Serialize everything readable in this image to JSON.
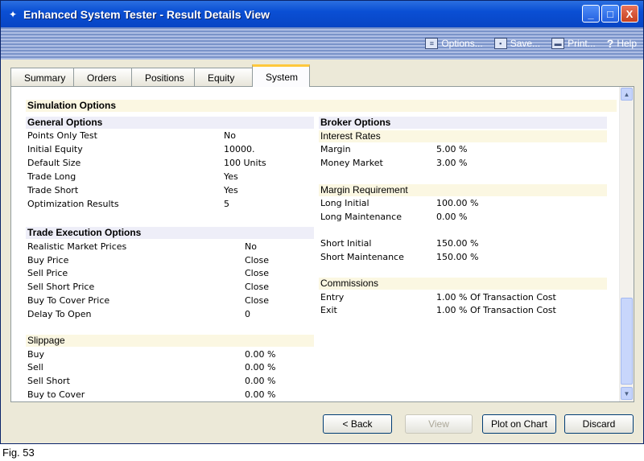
{
  "window": {
    "title": "Enhanced System Tester - Result Details View",
    "controls": {
      "minimize": "_",
      "maximize": "□",
      "close": "X"
    }
  },
  "toolbar": {
    "options_label": "Options...",
    "save_label": "Save...",
    "print_label": "Print...",
    "help_label": "Help"
  },
  "tabs": [
    {
      "label": "Summary"
    },
    {
      "label": "Orders"
    },
    {
      "label": "Positions"
    },
    {
      "label": "Equity"
    },
    {
      "label": "System"
    }
  ],
  "active_tab": "System",
  "simulation": {
    "title": "Simulation Options",
    "general": {
      "title": "General Options",
      "rows": [
        {
          "label": "Points Only Test",
          "value": "No"
        },
        {
          "label": "Initial Equity",
          "value": "10000."
        },
        {
          "label": "Default Size",
          "value": "100 Units"
        },
        {
          "label": "Trade Long",
          "value": "Yes"
        },
        {
          "label": "Trade Short",
          "value": "Yes"
        },
        {
          "label": "Optimization Results",
          "value": "5"
        }
      ]
    },
    "trade_execution": {
      "title": "Trade Execution Options",
      "rows": [
        {
          "label": "Realistic Market Prices",
          "value": "No"
        },
        {
          "label": "Buy Price",
          "value": "Close"
        },
        {
          "label": "Sell Price",
          "value": "Close"
        },
        {
          "label": "Sell Short Price",
          "value": "Close"
        },
        {
          "label": "Buy To Cover Price",
          "value": "Close"
        },
        {
          "label": "Delay To Open",
          "value": "0"
        }
      ]
    },
    "slippage": {
      "title": "Slippage",
      "rows": [
        {
          "label": "Buy",
          "value": "0.00 %"
        },
        {
          "label": "Sell",
          "value": "0.00 %"
        },
        {
          "label": "Sell Short",
          "value": "0.00 %"
        },
        {
          "label": "Buy to Cover",
          "value": "0.00 %"
        }
      ]
    },
    "broker": {
      "title": "Broker Options",
      "interest": {
        "title": "Interest Rates",
        "rows": [
          {
            "label": "Margin",
            "value": "5.00 %"
          },
          {
            "label": "Money Market",
            "value": "3.00 %"
          }
        ]
      },
      "margin_req": {
        "title": "Margin Requirement",
        "rows": [
          {
            "label": "Long Initial",
            "value": "100.00 %"
          },
          {
            "label": "Long Maintenance",
            "value": "0.00 %"
          },
          {
            "label": "Short Initial",
            "value": "150.00 %"
          },
          {
            "label": "Short Maintenance",
            "value": "150.00 %"
          }
        ]
      },
      "commissions": {
        "title": "Commissions",
        "rows": [
          {
            "label": "Entry",
            "value": "1.00 % Of Transaction Cost"
          },
          {
            "label": "Exit",
            "value": "1.00 % Of Transaction Cost"
          }
        ]
      }
    }
  },
  "buttons": {
    "back": "< Back",
    "view": "View",
    "plot": "Plot on Chart",
    "discard": "Discard"
  },
  "caption": "Fig. 53"
}
